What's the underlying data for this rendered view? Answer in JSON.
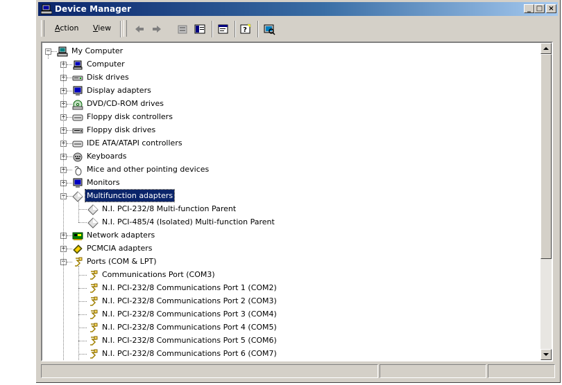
{
  "window": {
    "title": "Device Manager"
  },
  "caption_buttons": {
    "minimize": "_",
    "maximize": "□",
    "close": "×"
  },
  "menu": {
    "action_underline": "A",
    "action_rest": "ction",
    "view_underline": "V",
    "view_rest": "iew"
  },
  "tree": {
    "root": "My Computer",
    "categories": [
      {
        "label": "Computer",
        "icon": "computer-icon"
      },
      {
        "label": "Disk drives",
        "icon": "disk-drive-icon"
      },
      {
        "label": "Display adapters",
        "icon": "monitor-icon"
      },
      {
        "label": "DVD/CD-ROM drives",
        "icon": "cdrom-icon"
      },
      {
        "label": "Floppy disk controllers",
        "icon": "controller-icon"
      },
      {
        "label": "Floppy disk drives",
        "icon": "floppy-drive-icon"
      },
      {
        "label": "IDE ATA/ATAPI controllers",
        "icon": "controller-icon"
      },
      {
        "label": "Keyboards",
        "icon": "keyboard-icon"
      },
      {
        "label": "Mice and other pointing devices",
        "icon": "mouse-icon"
      },
      {
        "label": "Monitors",
        "icon": "monitor-icon"
      }
    ],
    "multifunction": {
      "label": "Multifunction adapters",
      "children": [
        "N.I. PCI-232/8 Multi-function Parent",
        "N.I. PCI-485/4 (Isolated) Multi-function Parent"
      ]
    },
    "after_multifunction": [
      {
        "label": "Network adapters",
        "icon": "network-adapter-icon"
      },
      {
        "label": "PCMCIA adapters",
        "icon": "pcmcia-icon"
      }
    ],
    "ports": {
      "label": "Ports (COM & LPT)",
      "children": [
        "Communications Port (COM3)",
        "N.I. PCI-232/8 Communications Port 1 (COM2)",
        "N.I. PCI-232/8 Communications Port 2 (COM3)",
        "N.I. PCI-232/8 Communications Port 3 (COM4)",
        "N.I. PCI-232/8 Communications Port 4 (COM5)",
        "N.I. PCI-232/8 Communications Port 5 (COM6)",
        "N.I. PCI-232/8 Communications Port 6 (COM7)"
      ]
    }
  },
  "colors": {
    "selection": "#0a246a",
    "titlebar_start": "#0a246a",
    "titlebar_end": "#a6caf0",
    "face": "#d4d0c8"
  }
}
